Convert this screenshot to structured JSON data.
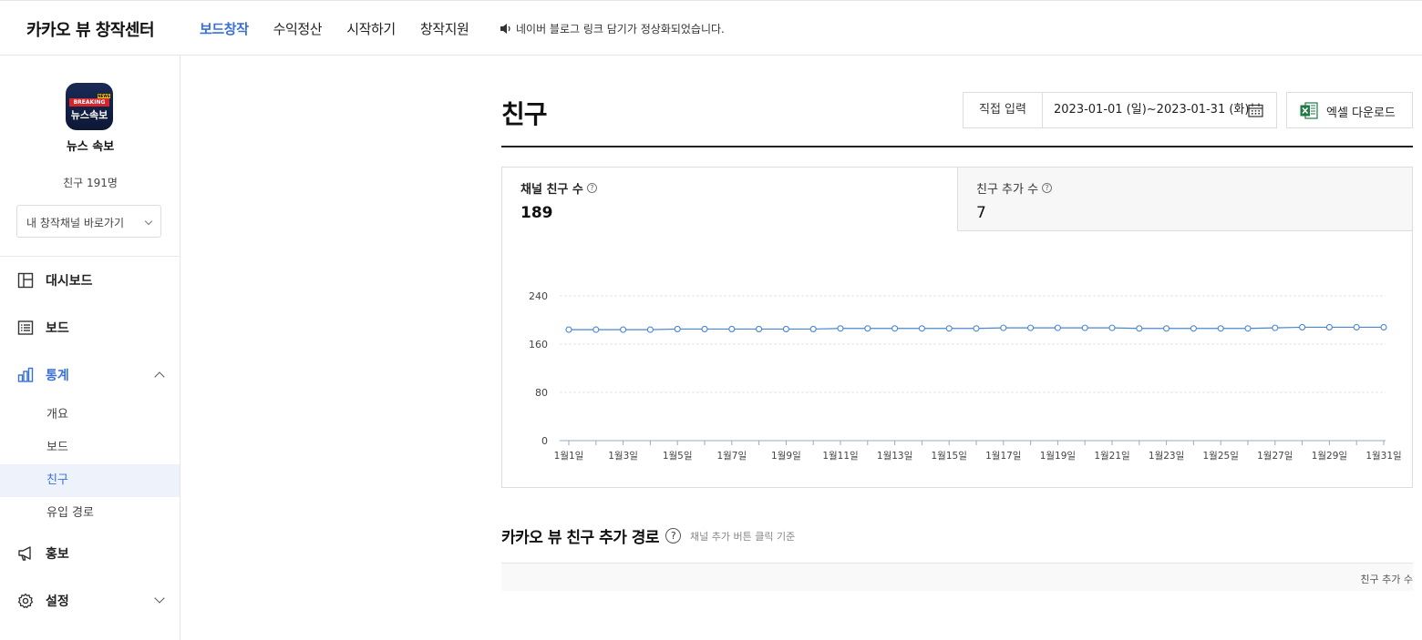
{
  "header": {
    "brand": "카카오 뷰 창작센터",
    "nav": [
      "보드창작",
      "수익정산",
      "시작하기",
      "창작지원"
    ],
    "notice": "네이버 블로그 링크 담기가 정상화되었습니다."
  },
  "sidebar": {
    "avatar": {
      "banner": "BREAKING",
      "tag": "NEWS",
      "text": "뉴스속보"
    },
    "channel_name": "뉴스 속보",
    "friends": "친구 191명",
    "channel_select": "내 창작채널 바로가기",
    "menu": {
      "dashboard": "대시보드",
      "board": "보드",
      "stats": "통계",
      "stats_sub": [
        "개요",
        "보드",
        "친구",
        "유입 경로"
      ],
      "promo": "홍보",
      "settings": "설정"
    }
  },
  "main": {
    "title": "친구",
    "date_mode": "직접 입력",
    "date_range": "2023-01-01 (일)~2023-01-31 (화)",
    "excel": "엑셀 다운로드",
    "tabs": [
      {
        "label": "채널 친구 수",
        "value": "189"
      },
      {
        "label": "친구 추가 수",
        "value": "7"
      }
    ],
    "route_title": "카카오 뷰 친구 추가 경로",
    "route_sub": "채널 추가 버튼 클릭 기준",
    "route_column": "친구 추가 수"
  },
  "colors": {
    "accent": "#3a70d8",
    "line": "#4a86d0"
  },
  "chart_data": {
    "type": "line",
    "x": [
      "1월1일",
      "1월2일",
      "1월3일",
      "1월4일",
      "1월5일",
      "1월6일",
      "1월7일",
      "1월8일",
      "1월9일",
      "1월10일",
      "1월11일",
      "1월12일",
      "1월13일",
      "1월14일",
      "1월15일",
      "1월16일",
      "1월17일",
      "1월18일",
      "1월19일",
      "1월20일",
      "1월21일",
      "1월22일",
      "1월23일",
      "1월24일",
      "1월25일",
      "1월26일",
      "1월27일",
      "1월28일",
      "1월29일",
      "1월30일",
      "1월31일"
    ],
    "x_tick_labels": [
      "1월1일",
      "1월3일",
      "1월5일",
      "1월7일",
      "1월9일",
      "1월11일",
      "1월13일",
      "1월15일",
      "1월17일",
      "1월19일",
      "1월21일",
      "1월23일",
      "1월25일",
      "1월27일",
      "1월29일",
      "1월31일"
    ],
    "values": [
      184,
      184,
      184,
      184,
      185,
      185,
      185,
      185,
      185,
      185,
      186,
      186,
      186,
      186,
      186,
      186,
      187,
      187,
      187,
      187,
      187,
      186,
      186,
      186,
      186,
      186,
      187,
      188,
      188,
      188,
      188
    ],
    "yticks": [
      0,
      80,
      160,
      240
    ],
    "ylim": [
      0,
      240
    ],
    "grid": true
  }
}
